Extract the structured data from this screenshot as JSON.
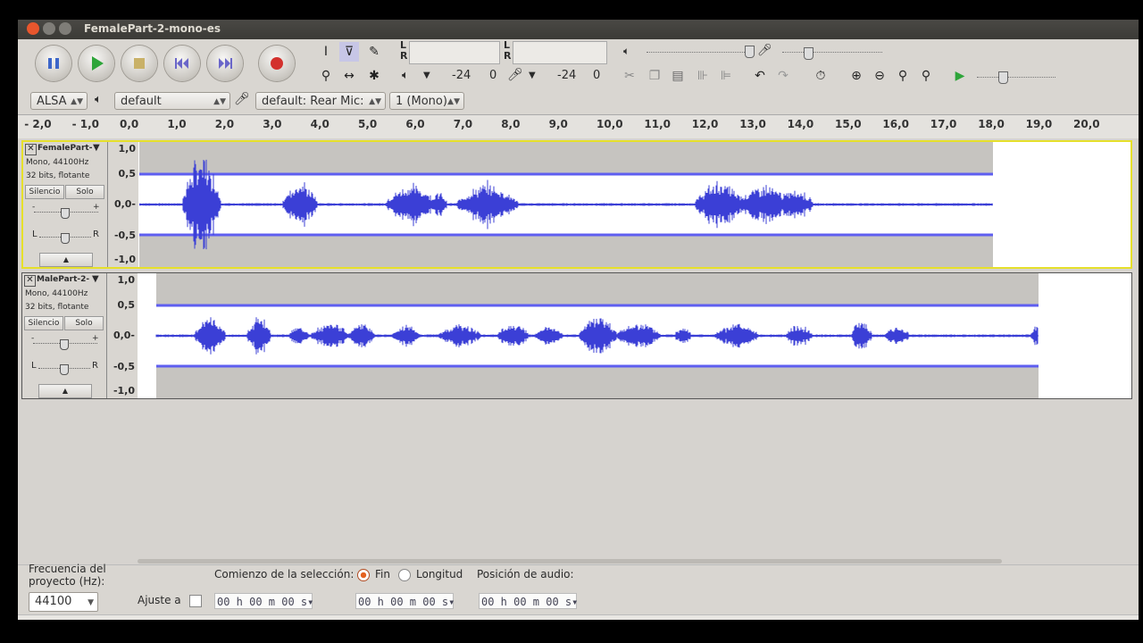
{
  "window": {
    "title": "FemalePart-2-mono-es"
  },
  "transport": {
    "pause": "pause-icon",
    "play": "play-icon",
    "stop": "stop-icon",
    "skip_start": "skip-start-icon",
    "skip_end": "skip-end-icon",
    "record": "record-icon"
  },
  "meters": {
    "L": "L",
    "R": "R",
    "play_db": "-24",
    "play_zero": "0",
    "rec_db": "-24",
    "rec_zero": "0"
  },
  "device": {
    "host": "ALSA",
    "output": "default",
    "input": "default: Rear Mic:",
    "channels": "1 (Mono)"
  },
  "ruler": {
    "ticks": [
      "- 2,0",
      "- 1,0",
      "0,0",
      "1,0",
      "2,0",
      "3,0",
      "4,0",
      "5,0",
      "6,0",
      "7,0",
      "8,0",
      "9,0",
      "10,0",
      "11,0",
      "12,0",
      "13,0",
      "14,0",
      "15,0",
      "16,0",
      "17,0",
      "18,0",
      "19,0",
      "20,0"
    ]
  },
  "tracks": [
    {
      "name": "FemalePart-",
      "info1": "Mono, 44100Hz",
      "info2": "32 bits, flotante",
      "mute": "Silencio",
      "solo": "Solo",
      "gain_minus": "-",
      "gain_plus": "+",
      "pan_left": "L",
      "pan_right": "R",
      "scale": [
        "1,0",
        "0,5",
        "0,0-",
        "-0,5",
        "-1,0"
      ]
    },
    {
      "name": "MalePart-2-",
      "info1": "Mono, 44100Hz",
      "info2": "32 bits, flotante",
      "mute": "Silencio",
      "solo": "Solo",
      "gain_minus": "-",
      "gain_plus": "+",
      "pan_left": "L",
      "pan_right": "R",
      "scale": [
        "1,0",
        "0,5",
        "0,0-",
        "-0,5",
        "-1,0"
      ]
    }
  ],
  "selection": {
    "rate_label": "Frecuencia del proyecto (Hz):",
    "rate_value": "44100",
    "snap_label": "Ajuste a",
    "start_label": "Comienzo de la selección:",
    "end_radio": "Fin",
    "length_radio": "Longitud",
    "audio_pos_label": "Posición de audio:",
    "start_time": "00 h 00 m 00 s",
    "end_time": "00 h 00 m 00 s",
    "audio_pos_time": "00 h 00 m 00 s"
  },
  "colors": {
    "wave": "#3b3fd6",
    "envelope": "#5e5ef0",
    "track_bg": "#ffffff",
    "selected_bg": "#c6c4c0",
    "titlebar": "#3c3b37"
  }
}
